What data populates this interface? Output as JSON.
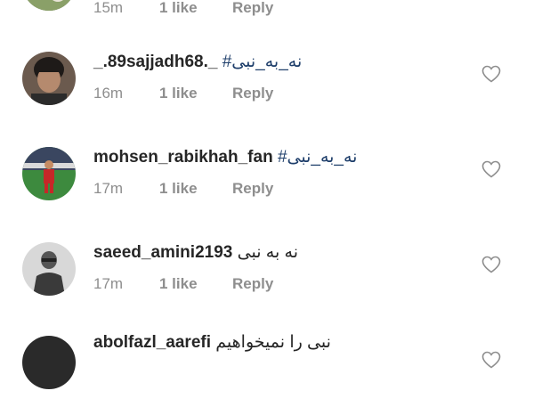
{
  "partial_top": {
    "time": "15m",
    "likes": "1 like",
    "reply": "Reply"
  },
  "comments": [
    {
      "username": "_.89sajjadh68._",
      "text": "",
      "hashtag": "#نه_به_نبی",
      "time": "16m",
      "likes": "1 like",
      "reply": "Reply",
      "avatar": "man-with-dark-hair-avatar"
    },
    {
      "username": "mohsen_rabikhah_fan",
      "text": "",
      "hashtag": "#نه_به_نبی",
      "time": "17m",
      "likes": "1 like",
      "reply": "Reply",
      "avatar": "football-player-red-kit-avatar"
    },
    {
      "username": "saeed_amini2193",
      "text": "نه به نبی",
      "hashtag": "",
      "time": "17m",
      "likes": "1 like",
      "reply": "Reply",
      "avatar": "grayscale-man-portrait-avatar"
    },
    {
      "username": "abolfazl_aarefi",
      "text": "نبی را نمیخواهیم",
      "hashtag": "",
      "time": "",
      "likes": "",
      "reply": "",
      "avatar": "dark-avatar"
    }
  ],
  "colors": {
    "username": "#262626",
    "meta": "#8e8e8e",
    "hashtag": "#1f3f6b",
    "heart_outline": "#8e8e8e"
  }
}
